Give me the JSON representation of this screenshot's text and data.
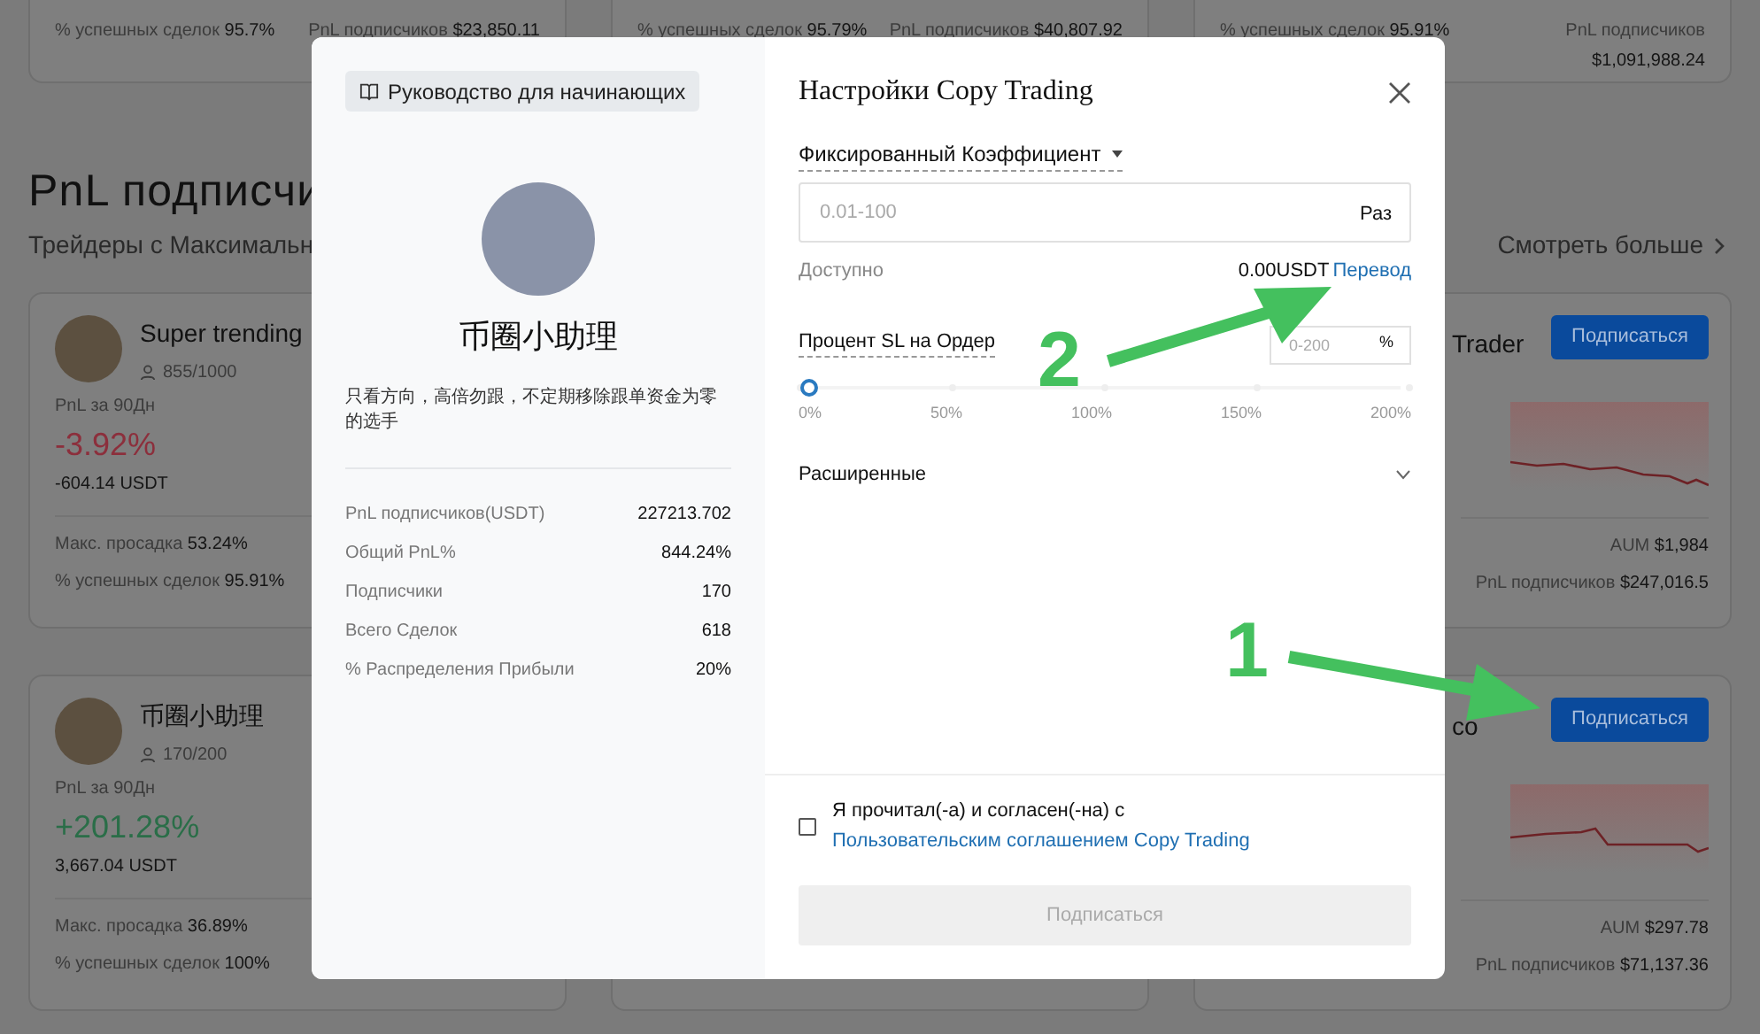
{
  "top_cards": [
    {
      "left": {
        "label": "% успешных сделок",
        "value": "95.7%"
      },
      "right": {
        "label": "PnL подписчиков",
        "value": "$23,850.11"
      }
    },
    {
      "left": {
        "label": "% успешных сделок",
        "value": "95.79%"
      },
      "right": {
        "label": "PnL подписчиков",
        "value": "$40,807.92"
      }
    },
    {
      "left": {
        "label": "% успешных сделок",
        "value": "95.91%"
      },
      "right": {
        "label": "PnL подписчиков",
        "value": "$1,091,988.24"
      }
    }
  ],
  "section": {
    "title": "PnL подписчи",
    "subtitle": "Трейдеры с Максимальн",
    "more_link": "Смотреть больше"
  },
  "trader_rows": [
    {
      "left": {
        "name": "Super trending",
        "followers": "855/1000",
        "pnl_label": "PnL за 90Дн",
        "pnl": "-3.92%",
        "color": "#8c2f3c",
        "pnl_usdt": "-604.14 USDT",
        "stats": [
          {
            "label": "Макс. просадка",
            "value": "53.24%"
          },
          {
            "label": "% успешных сделок",
            "value": "95.91%"
          }
        ]
      },
      "right": {
        "name": "Trader",
        "button": "Подписаться",
        "stats": [
          {
            "label": "AUM",
            "value": "$1,984"
          },
          {
            "label": "PnL подписчиков",
            "value": "$247,016.5"
          }
        ]
      }
    },
    {
      "left": {
        "name": "币圈小助理",
        "followers": "170/200",
        "pnl_label": "PnL за 90Дн",
        "pnl": "+201.28%",
        "color": "#2a6e48",
        "pnl_usdt": "3,667.04 USDT",
        "stats": [
          {
            "label": "Макс. просадка",
            "value": "36.89%"
          },
          {
            "label": "% успешных сделок",
            "value": "100%"
          }
        ]
      },
      "right": {
        "name": "co",
        "button": "Подписаться",
        "stats": [
          {
            "label": "AUM",
            "value": "$297.78"
          },
          {
            "label": "PnL подписчиков",
            "value": "$71,137.36"
          }
        ]
      }
    }
  ],
  "modal": {
    "guide_button": "Руководство для начинающих",
    "trader_name": "币圈小助理",
    "description": "只看方向，高倍勿跟，不定期移除跟单资金为零的选手",
    "stats": [
      {
        "label": "PnL подписчиков(USDT)",
        "value": "227213.702"
      },
      {
        "label": "Общий PnL%",
        "value": "844.24%"
      },
      {
        "label": "Подписчики",
        "value": "170"
      },
      {
        "label": "Всего Сделок",
        "value": "618"
      },
      {
        "label": "% Распределения Прибыли",
        "value": "20%"
      }
    ],
    "title": "Настройки Copy Trading",
    "mode": "Фиксированный Коэффициент",
    "ratio_input": {
      "placeholder": "0.01-100",
      "unit": "Раз"
    },
    "available": {
      "label": "Доступно",
      "amount": "0.00USDT",
      "link": "Перевод"
    },
    "sl": {
      "label": "Процент SL на Ордер",
      "placeholder": "0-200",
      "unit": "%",
      "level": 0,
      "ticks": [
        "0%",
        "50%",
        "100%",
        "150%",
        "200%"
      ]
    },
    "advanced": {
      "label": "Расширенные",
      "expanded": false
    },
    "agreement": {
      "checked": false,
      "text": "Я прочитал(-а) и согласен(-на) с",
      "link": "Пользовательским соглашением Copy Trading"
    },
    "submit": {
      "label": "Подписаться",
      "disabled": true
    }
  },
  "annotations": [
    {
      "label": "1"
    },
    {
      "label": "2"
    }
  ]
}
